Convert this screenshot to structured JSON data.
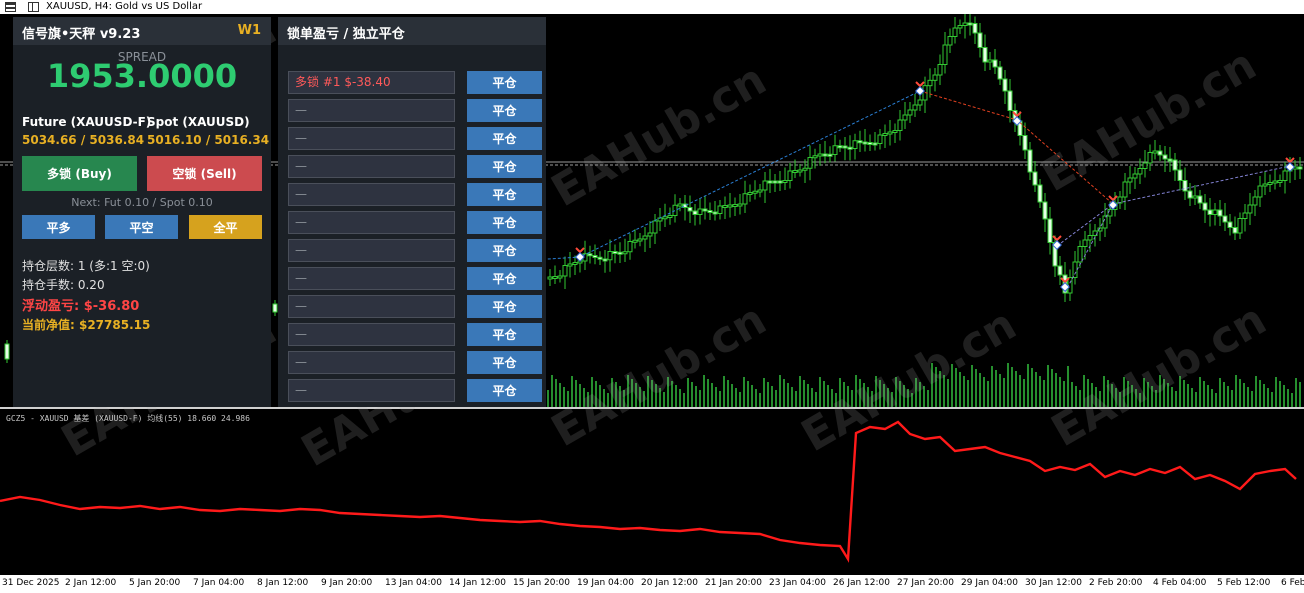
{
  "window": {
    "title": "XAUUSD, H4:  Gold vs US Dollar"
  },
  "panel": {
    "title": "信号旗•天秤 v9.23",
    "badge": "W1",
    "spread_label": "SPREAD",
    "spread_value": "1953.0000",
    "future_label": "Future (XAUUSD-F)",
    "future_value": "5034.66 / 5036.84",
    "spot_label": "Spot (XAUUSD)",
    "spot_value": "5016.10 / 5016.34",
    "buy_label": "多锁 (Buy)",
    "sell_label": "空锁 (Sell)",
    "next_label": "Next: Fut 0.10 / Spot 0.10",
    "close_long": "平多",
    "close_short": "平空",
    "close_all": "全平",
    "layers": "持仓层数: 1 (多:1 空:0)",
    "lots": "持仓手数: 0.20",
    "floating_pl": "浮动盈亏: $-36.80",
    "equity": "当前净值: $27785.15"
  },
  "lock_panel": {
    "title": "锁单盈亏 / 独立平仓",
    "close_button": "平仓",
    "rows": [
      "多锁 #1  $-38.40",
      "—",
      "—",
      "—",
      "—",
      "—",
      "—",
      "—",
      "—",
      "—",
      "—",
      "—"
    ]
  },
  "indicator": {
    "label": "GCZ5 - XAUUSD 基差 (XAUUSD-F) 均线(55) 18.660 24.986"
  },
  "watermark": "EAHub.cn",
  "time_axis": [
    "31 Dec 2025",
    "2 Jan 12:00",
    "5 Jan 20:00",
    "7 Jan 04:00",
    "8 Jan 12:00",
    "9 Jan 20:00",
    "13 Jan 04:00",
    "14 Jan 12:00",
    "15 Jan 20:00",
    "19 Jan 04:00",
    "20 Jan 12:00",
    "21 Jan 20:00",
    "23 Jan 04:00",
    "26 Jan 12:00",
    "27 Jan 20:00",
    "29 Jan 04:00",
    "30 Jan 12:00",
    "2 Feb 20:00",
    "4 Feb 04:00",
    "5 Feb 12:00",
    "6 Feb"
  ],
  "chart_data": [
    {
      "type": "line",
      "title": "XAUUSD, H4",
      "note": "candlestick price series (close, approximate)",
      "x": [
        "31 Dec 2025",
        "2 Jan 12:00",
        "5 Jan 20:00",
        "7 Jan 04:00",
        "8 Jan 12:00",
        "9 Jan 20:00",
        "13 Jan 04:00",
        "14 Jan 12:00",
        "15 Jan 20:00",
        "19 Jan 04:00",
        "20 Jan 12:00",
        "21 Jan 20:00",
        "23 Jan 04:00",
        "26 Jan 12:00",
        "27 Jan 20:00",
        "29 Jan 04:00",
        "30 Jan 12:00",
        "2 Feb 20:00",
        "4 Feb 04:00",
        "5 Feb 12:00",
        "6 Feb"
      ],
      "series": [
        {
          "values": [
            4320,
            4340,
            4360,
            4420,
            4450,
            4480,
            4560,
            4600,
            4610,
            4670,
            4740,
            4830,
            4920,
            4990,
            5100,
            5400,
            4900,
            4700,
            4950,
            4880,
            5010
          ]
        }
      ]
    },
    {
      "type": "line",
      "title": "GCZ5 - XAUUSD 基差 (XAUUSD-F) 均线(55)",
      "x": [
        "31 Dec 2025",
        "2 Jan 12:00",
        "5 Jan 20:00",
        "7 Jan 04:00",
        "8 Jan 12:00",
        "9 Jan 20:00",
        "13 Jan 04:00",
        "14 Jan 12:00",
        "15 Jan 20:00",
        "19 Jan 04:00",
        "20 Jan 12:00",
        "21 Jan 20:00",
        "23 Jan 04:00",
        "26 Jan 12:00",
        "27 Jan 20:00",
        "29 Jan 04:00",
        "30 Jan 12:00",
        "2 Feb 20:00",
        "4 Feb 04:00",
        "5 Feb 12:00",
        "6 Feb"
      ],
      "series": [
        {
          "name": "均线(55)",
          "color": "#ff0000",
          "values": [
            16.4,
            16.3,
            16.1,
            16.0,
            15.9,
            15.7,
            15.5,
            15.1,
            14.8,
            14.7,
            14.5,
            14.3,
            13.8,
            24.4,
            24.9,
            23.5,
            22.4,
            22.1,
            21.8,
            21.5,
            21.7
          ]
        }
      ]
    }
  ]
}
